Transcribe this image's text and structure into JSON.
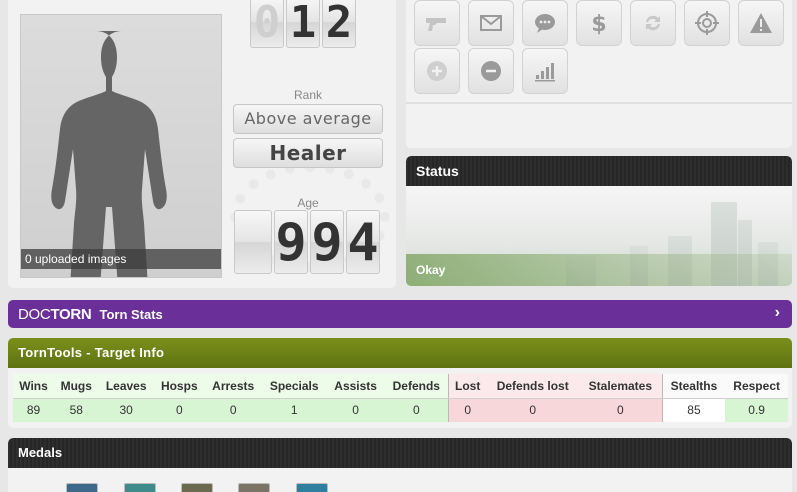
{
  "profile": {
    "photo_caption": "0 uploaded images",
    "level_digits": [
      "0",
      "1",
      "2"
    ],
    "rank_label": "Rank",
    "rank_value": "Above average",
    "class_value": "Healer",
    "age_label": "Age",
    "age_digits": [
      "",
      "9",
      "9",
      "4"
    ]
  },
  "actions": {
    "buttons": [
      {
        "icon": "gun-icon",
        "enabled": false
      },
      {
        "icon": "mail-icon",
        "enabled": true
      },
      {
        "icon": "chat-icon",
        "enabled": true
      },
      {
        "icon": "dollar-icon",
        "enabled": true
      },
      {
        "icon": "trade-icon",
        "enabled": false
      },
      {
        "icon": "target-icon",
        "enabled": true
      },
      {
        "icon": "warning-icon",
        "enabled": true
      },
      {
        "icon": "add-friend-icon",
        "enabled": false
      },
      {
        "icon": "remove-friend-icon",
        "enabled": true
      },
      {
        "icon": "stats-icon",
        "enabled": true
      }
    ]
  },
  "status": {
    "header": "Status",
    "state": "Okay"
  },
  "doctorn": {
    "logo_doc": "DOC",
    "logo_torn": "TORN",
    "title": "Torn Stats"
  },
  "torntools": {
    "header": "TornTools - Target Info",
    "columns": [
      "Wins",
      "Mugs",
      "Leaves",
      "Hosps",
      "Arrests",
      "Specials",
      "Assists",
      "Defends",
      "Lost",
      "Defends lost",
      "Stalemates",
      "Stealths",
      "Respect"
    ],
    "values": [
      "89",
      "58",
      "30",
      "0",
      "0",
      "1",
      "0",
      "0",
      "0",
      "0",
      "0",
      "85",
      "0.9"
    ]
  },
  "medals": {
    "header": "Medals"
  },
  "colors": {
    "doctorn_purple": "#6a2f98",
    "torntools_green": "#6a7f16",
    "good_cell": "#d8f5d3",
    "bad_cell": "#f8d7da"
  }
}
